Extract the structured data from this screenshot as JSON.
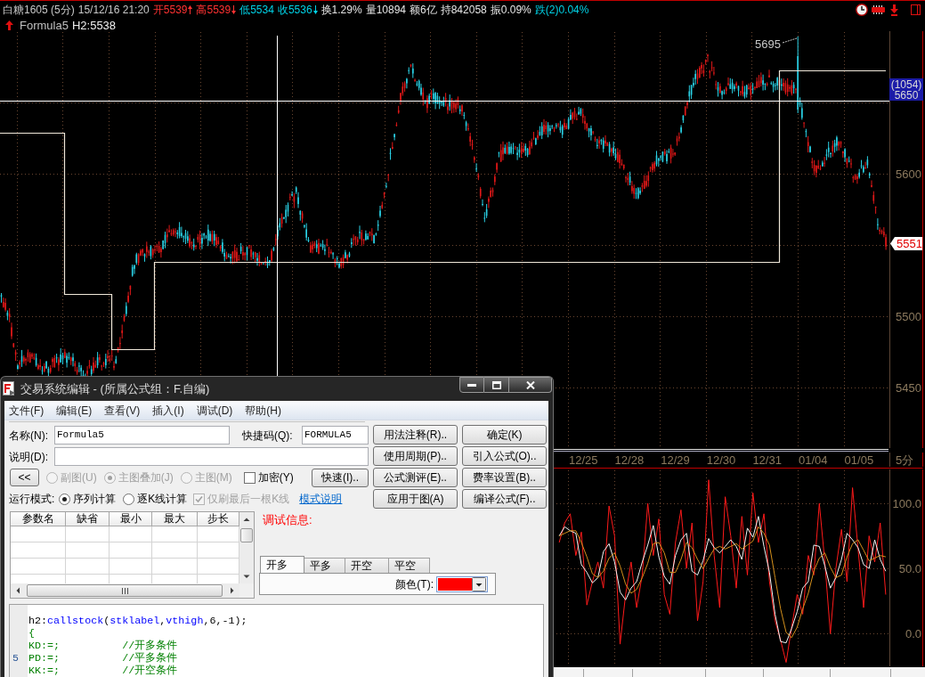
{
  "quote_bar": {
    "items": [
      {
        "text": "白糖1605 (5分)",
        "color": "#c8c8c8",
        "kind": "plain"
      },
      {
        "text": "15/12/16 21:20",
        "color": "#c8c8c8",
        "kind": "plain"
      },
      {
        "text": "开5539",
        "color": "#ff3232",
        "kind": "rising"
      },
      {
        "text": "高5539",
        "color": "#ff3232",
        "kind": "falling"
      },
      {
        "text": "低5534",
        "color": "#00d2e6",
        "kind": "plain"
      },
      {
        "text": "收5536",
        "color": "#00d2e6",
        "kind": "falling"
      },
      {
        "text": "换1.29%",
        "color": "#e6e6e6",
        "kind": "plain"
      },
      {
        "text": "量10894",
        "color": "#e6e6e6",
        "kind": "plain"
      },
      {
        "text": "额6亿",
        "color": "#e6e6e6",
        "kind": "plain"
      },
      {
        "text": "持842058",
        "color": "#e6e6e6",
        "kind": "plain"
      },
      {
        "text": "振0.09%",
        "color": "#e6e6e6",
        "kind": "plain"
      },
      {
        "text": "跌(2)0.04%",
        "color": "#00d2e6",
        "kind": "plain"
      }
    ]
  },
  "indicator_line": {
    "name": "Formula5",
    "value": "H2:5538"
  },
  "price_chart": {
    "axis_labels": [
      "5600",
      "5500",
      "5450"
    ],
    "peak_label": "5695",
    "crosshair_label": {
      "bars": "(1054)",
      "price": "5650"
    },
    "last_price": "5551"
  },
  "date_axis": {
    "labels": [
      "12/25",
      "12/28",
      "12/29",
      "12/30",
      "12/31",
      "01/04",
      "01/05"
    ],
    "period": "5分"
  },
  "oscillator": {
    "chart_data": {
      "type": "line",
      "ylim": [
        -25,
        126
      ],
      "grid": true,
      "yticks": [
        {
          "value": 100,
          "label": "100.0"
        },
        {
          "value": 50,
          "label": "50.0"
        },
        {
          "value": 0,
          "label": "0.0"
        }
      ],
      "series": [
        {
          "color": "#ff1a1a",
          "values": [
            70,
            85,
            92,
            60,
            78,
            22,
            40,
            55,
            35,
            98,
            75,
            -8,
            30,
            55,
            20,
            45,
            100,
            60,
            88,
            30,
            15,
            70,
            95,
            50,
            85,
            10,
            40,
            118,
            60,
            20,
            105,
            75,
            35,
            90,
            45,
            108,
            70,
            92,
            40,
            10,
            -5,
            -22,
            5,
            30,
            15,
            60,
            45,
            100,
            55,
            0,
            50,
            80,
            40,
            112,
            65,
            20,
            75,
            55,
            85,
            30
          ]
        },
        {
          "color": "#f4f4f4",
          "values": [
            75,
            82,
            79,
            77,
            53,
            47,
            39,
            43,
            63,
            69,
            55,
            32,
            26,
            35,
            40,
            55,
            68,
            83,
            59,
            44,
            38,
            60,
            72,
            77,
            48,
            45,
            56,
            73,
            66,
            62,
            67,
            72,
            67,
            57,
            81,
            74,
            90,
            67,
            47,
            15,
            -6,
            -7,
            4,
            17,
            35,
            40,
            68,
            67,
            52,
            35,
            43,
            57,
            77,
            72,
            66,
            53,
            50,
            72,
            57,
            48
          ]
        },
        {
          "color": "#d4901c",
          "values": [
            75,
            77,
            79,
            79,
            70,
            59,
            46,
            43,
            48,
            58,
            62,
            52,
            38,
            31,
            34,
            43,
            54,
            69,
            70,
            62,
            47,
            47,
            57,
            70,
            66,
            57,
            50,
            58,
            65,
            67,
            65,
            67,
            69,
            65,
            68,
            71,
            82,
            77,
            68,
            43,
            19,
            1,
            -3,
            5,
            19,
            31,
            48,
            58,
            62,
            51,
            43,
            45,
            59,
            69,
            72,
            64,
            56,
            58,
            60,
            59
          ]
        }
      ]
    }
  },
  "dialog": {
    "title": "交易系统编辑 - (所属公式组：F.自编)",
    "menu": [
      "文件(F)",
      "编辑(E)",
      "查看(V)",
      "插入(I)",
      "调试(D)",
      "帮助(H)"
    ],
    "name_field": {
      "label": "名称(N):",
      "value": "Formula5"
    },
    "shortcut_field": {
      "label": "快捷码(Q):",
      "value": "FORMULA5"
    },
    "description_field": {
      "label": "说明(D):"
    },
    "collapse_button": "<<",
    "chart_modes": [
      {
        "label": "副图(U)",
        "selected": false,
        "disabled": true
      },
      {
        "label": "主图叠加(J)",
        "selected": true,
        "disabled": true
      },
      {
        "label": "主图(M)",
        "selected": false,
        "disabled": true
      }
    ],
    "encrypt_checkbox": {
      "label": "加密(Y)",
      "checked": false,
      "disabled": false
    },
    "quick_button": "快速(I)..",
    "run_mode": {
      "label": "运行模式:",
      "options": [
        {
          "label": "序列计算",
          "selected": true
        },
        {
          "label": "逐K线计算",
          "selected": false
        }
      ],
      "refresh_checkbox": {
        "label": "仅刷最后一根K线",
        "checked": true,
        "disabled": true
      },
      "help_link": "模式说明"
    },
    "side_buttons": [
      "用法注释(R)..",
      "确定(K)",
      "使用周期(P)..",
      "引入公式(O)..",
      "公式测评(E)..",
      "费率设置(B)..",
      "应用于图(A)",
      "编译公式(F).."
    ],
    "param_table": {
      "columns": [
        "参数名",
        "缺省",
        "最小",
        "最大",
        "步长"
      ]
    },
    "debug_label": "调试信息:",
    "signal_tabs": [
      {
        "label": "开多",
        "selected": true
      },
      {
        "label": "平多",
        "selected": false
      },
      {
        "label": "开空",
        "selected": false
      },
      {
        "label": "平空",
        "selected": false
      }
    ],
    "color_field": {
      "label": "颜色(T):",
      "color": "#ff0000"
    },
    "code_lines": [
      {
        "tokens": [
          {
            "kind": "plain",
            "text": "h2:"
          },
          {
            "kind": "function",
            "text": "callstock"
          },
          {
            "kind": "plain",
            "text": "("
          },
          {
            "kind": "function",
            "text": "stklabel"
          },
          {
            "kind": "plain",
            "text": ","
          },
          {
            "kind": "function",
            "text": "vthigh"
          },
          {
            "kind": "plain",
            "text": ",6,-1);"
          }
        ]
      },
      {
        "tokens": [
          {
            "kind": "comment",
            "text": "{"
          }
        ]
      },
      {
        "tokens": [
          {
            "kind": "comment",
            "text": "KD:=;          //开多条件"
          }
        ]
      },
      {
        "line_number": "5",
        "tokens": [
          {
            "kind": "comment",
            "text": "PD:=;          //平多条件"
          }
        ]
      },
      {
        "tokens": [
          {
            "kind": "comment",
            "text": "KK:=;          //开空条件"
          }
        ]
      }
    ]
  }
}
